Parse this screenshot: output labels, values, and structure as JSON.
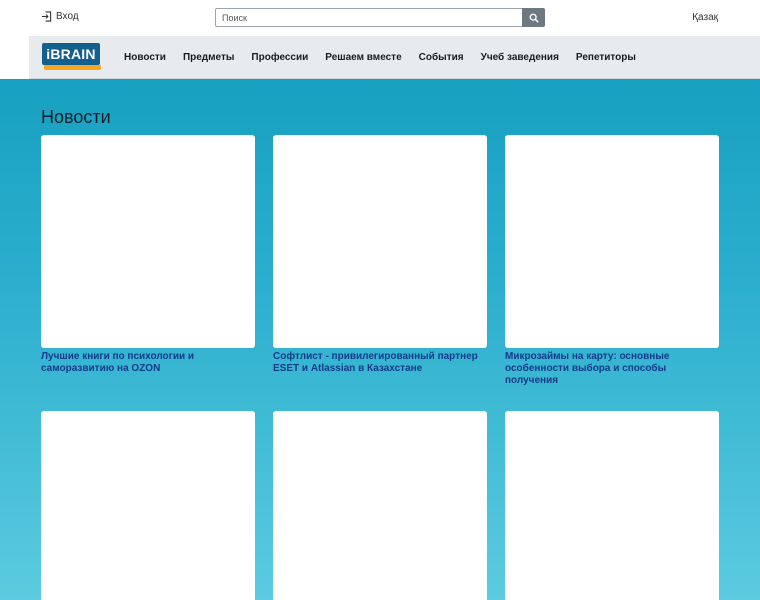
{
  "header": {
    "login_label": "Вход",
    "search_placeholder": "Поиск",
    "search_value": "",
    "language_label": "Қазақ"
  },
  "logo": {
    "text": "iBRAIN"
  },
  "nav": {
    "items": [
      {
        "label": "Новости"
      },
      {
        "label": "Предметы"
      },
      {
        "label": "Профессии"
      },
      {
        "label": "Решаем вместе"
      },
      {
        "label": "События"
      },
      {
        "label": "Учеб заведения"
      },
      {
        "label": "Репетиторы"
      }
    ]
  },
  "main": {
    "section_title": "Новости",
    "cards": [
      {
        "title": "Лучшие книги по психологии и саморазвитию на OZON"
      },
      {
        "title": "Софтлист - привилегированный партнер ESET и Atlassian в Казахстане"
      },
      {
        "title": "Микрозаймы на карту: основные особенности выбора и способы получения"
      },
      {
        "title": ""
      },
      {
        "title": ""
      },
      {
        "title": ""
      }
    ]
  },
  "colors": {
    "background_top": "#17a0c1",
    "background_bottom": "#5ccbe0",
    "logo_blue": "#13608f",
    "logo_orange": "#f5a623",
    "card_title": "#123b8a",
    "navbar_bg": "#e8ebee"
  },
  "icons": {
    "login": "login-icon",
    "search": "search-icon"
  }
}
